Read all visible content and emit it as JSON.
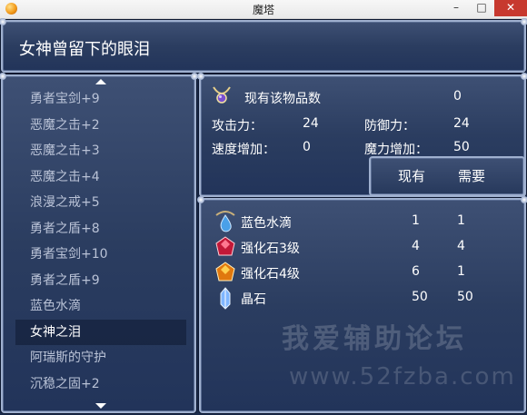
{
  "window": {
    "title": "魔塔"
  },
  "header": {
    "title": "女神曾留下的眼泪"
  },
  "list": {
    "items": [
      "勇者宝剑+9",
      "恶魔之击+2",
      "恶魔之击+3",
      "恶魔之击+4",
      "浪漫之戒+5",
      "勇者之盾+8",
      "勇者宝剑+10",
      "勇者之盾+9",
      "蓝色水滴",
      "女神之泪",
      "阿瑞斯的守护",
      "沉稳之固+2"
    ],
    "selected_index": 9
  },
  "info": {
    "owned_label": "现有该物品数",
    "owned_value": "0",
    "attack_label": "攻击力：",
    "attack_value": "24",
    "defense_label": "防御力：",
    "defense_value": "24",
    "speed_label": "速度增加：",
    "speed_value": "0",
    "magic_label": "魔力增加：",
    "magic_value": "50",
    "tab_have": "现有",
    "tab_need": "需要"
  },
  "materials": [
    {
      "icon": "blue-water-drop-icon",
      "name": "蓝色水滴",
      "have": "1",
      "need": "1"
    },
    {
      "icon": "red-gem-icon",
      "name": "强化石3级",
      "have": "4",
      "need": "4"
    },
    {
      "icon": "orange-gem-icon",
      "name": "强化石4级",
      "have": "6",
      "need": "1"
    },
    {
      "icon": "blue-crystal-icon",
      "name": "晶石",
      "have": "50",
      "need": "50"
    }
  ],
  "watermark": {
    "line1": "我爱辅助论坛",
    "line2": "www.52fzba.com"
  },
  "colors": {
    "panel_top": "#3e5074",
    "panel_bottom": "#22345a",
    "border": "#9fb0cf",
    "list_text": "#b9c2d6"
  }
}
